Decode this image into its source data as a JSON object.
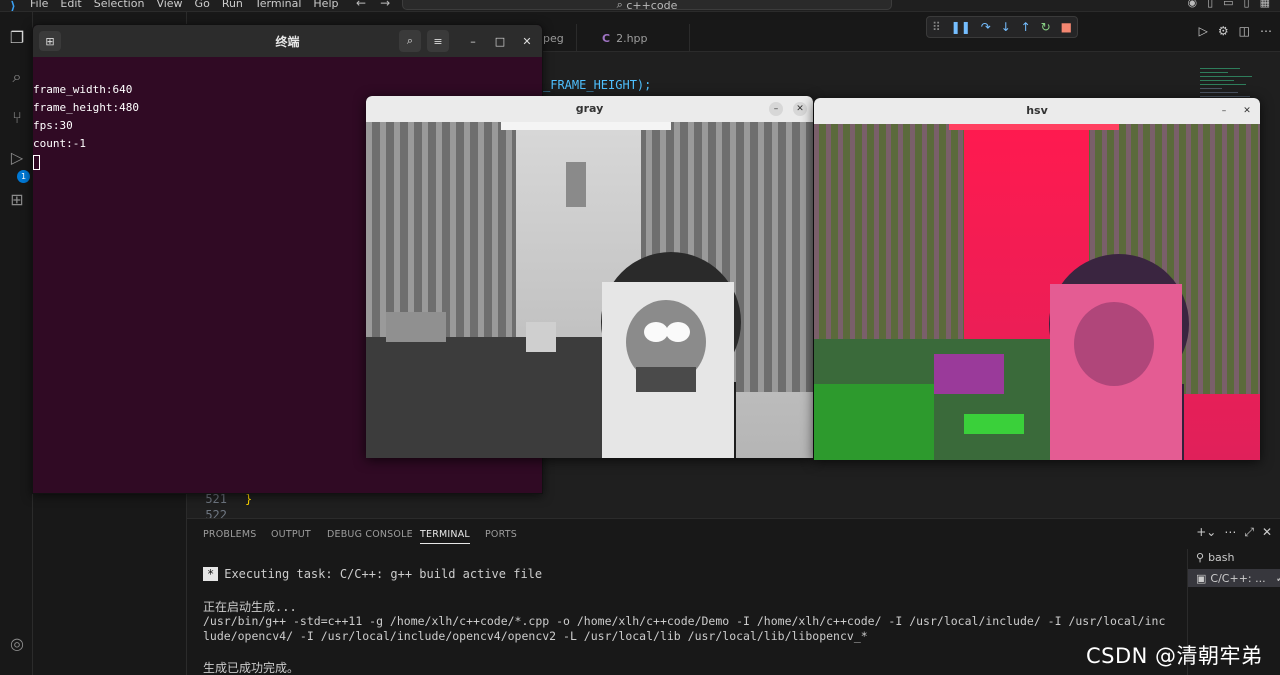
{
  "vscode": {
    "menu": [
      "File",
      "Edit",
      "Selection",
      "View",
      "Go",
      "Run",
      "Terminal",
      "Help"
    ],
    "search_text": "c++code",
    "tabs": [
      {
        "label": "peg"
      },
      {
        "label": "2.hpp",
        "icon": "C"
      }
    ],
    "code_fragment": "_FRAME_HEIGHT);",
    "line_numbers": [
      "521",
      "522"
    ],
    "code_line_521": "}",
    "panel_tabs": [
      "PROBLEMS",
      "OUTPUT",
      "DEBUG CONSOLE",
      "TERMINAL",
      "PORTS"
    ],
    "active_panel_tab": "TERMINAL",
    "terminal_output": {
      "task_marker": "*",
      "task_line": "Executing task: C/C++: g++ build active file",
      "starting": "正在启动生成...",
      "cmd_line1": "/usr/bin/g++ -std=c++11 -g /home/xlh/c++code/*.cpp -o /home/xlh/c++code/Demo -I /home/xlh/c++code/ -I /usr/local/include/ -I /usr/local/inc",
      "cmd_line2": "lude/opencv4/ -I /usr/local/include/opencv4/opencv2 -L /usr/local/lib /usr/local/lib/libopencv_*",
      "done": "生成已成功完成。"
    },
    "terminal_list": [
      {
        "label": "bash"
      },
      {
        "label": "C/C++: ..."
      }
    ],
    "debug_badge": "1",
    "icons": [
      "files-icon",
      "search-icon",
      "source-control-icon",
      "run-debug-icon",
      "extensions-icon",
      "account-icon"
    ]
  },
  "ubuntu_terminal": {
    "title": "终端",
    "lines": [
      "frame_width:640",
      "frame_height:480",
      "fps:30",
      "count:-1"
    ]
  },
  "windows": {
    "gray": {
      "title": "gray"
    },
    "hsv": {
      "title": "hsv"
    }
  },
  "watermark": "CSDN @清朝牢弟",
  "colors": {
    "terminal_bg": "#300a24",
    "hsv_red": "#ff1a4f",
    "accent": "#0078d4"
  }
}
